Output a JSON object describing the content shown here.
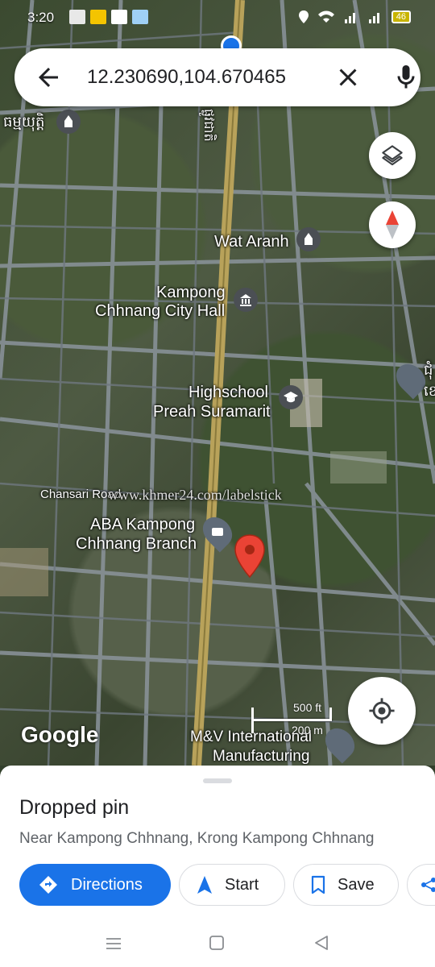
{
  "status_bar": {
    "time": "3:20",
    "battery": "46"
  },
  "search": {
    "query": "12.230690,104.670465"
  },
  "map": {
    "labels": {
      "top_left_khmer": "ធម្មយុត្តិ",
      "road_vertical_khmer": "ផ្លូវជាតិ",
      "wat_aranh": "Wat Aranh",
      "city_hall_line1": "Kampong",
      "city_hall_line2": "Chhnang City Hall",
      "highschool_line1": "Highschool",
      "highschool_line2": "Preah Suramarit",
      "chansari_road": "Chansari Road",
      "watermark": "www.khmer24.com/labelstick",
      "aba_line1": "ABA Kampong",
      "aba_line2": "Chhnang Branch",
      "mv_line1": "M&V International",
      "mv_line2": "Manufacturing",
      "right_edge_text": "ជុំ",
      "right_edge_text2": "ខេ"
    },
    "scale_ft": "500 ft",
    "scale_m": "200 m",
    "logo": "Google"
  },
  "sheet": {
    "title": "Dropped pin",
    "subtitle": "Near Kampong Chhnang, Krong Kampong Chhnang",
    "directions_label": "Directions",
    "start_label": "Start",
    "save_label": "Save"
  },
  "colors": {
    "accent": "#1a73e8",
    "pin": "#ea4335",
    "road_main": "#b8a25a"
  }
}
